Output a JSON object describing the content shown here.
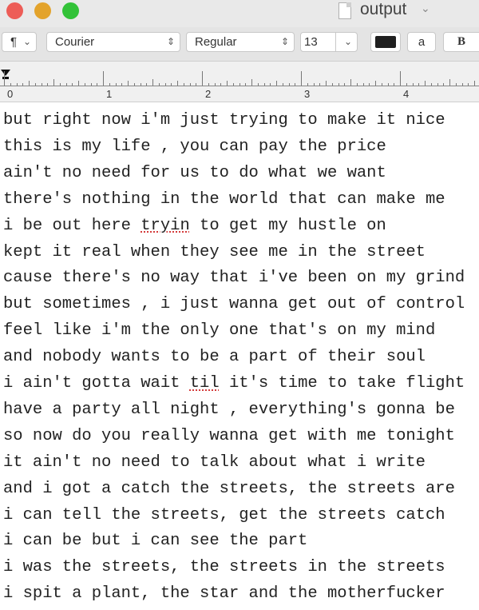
{
  "window": {
    "title": "output"
  },
  "toolbar": {
    "paragraph_icon": "¶",
    "font_family": "Courier",
    "font_style": "Regular",
    "font_size": "13",
    "highlight_label": "a",
    "bold_label": "B"
  },
  "ruler": {
    "numbers": [
      "0",
      "1",
      "2",
      "3",
      "4"
    ]
  },
  "editor": {
    "lines": [
      [
        "but right now i'm just trying to make it nice"
      ],
      [
        "this is my life , you can pay the price"
      ],
      [
        "ain't no need for us to do what we want"
      ],
      [
        "there's nothing in the world that can make me"
      ],
      [
        "i be out here ",
        "tryin",
        " to get my hustle on"
      ],
      [
        "kept it real when they see me in the street"
      ],
      [
        "cause there's no way that i've been on my grind"
      ],
      [
        "but sometimes , i just wanna get out of control"
      ],
      [
        "feel like i'm the only one that's on my mind"
      ],
      [
        "and nobody wants to be a part of their soul"
      ],
      [
        "i ain't gotta wait ",
        "til",
        " it's time to take flight"
      ],
      [
        "have a party all night , everything's gonna be"
      ],
      [
        "so now do you really wanna get with me tonight"
      ],
      [
        "it ain't no need to talk about what i write"
      ],
      [
        "and i got a catch the streets, the streets are"
      ],
      [
        "i can tell the streets, get the streets catch"
      ],
      [
        "i can be but i can see the part"
      ],
      [
        "i was the streets, the streets in the streets"
      ],
      [
        "i spit a plant, the star and the motherfucker"
      ]
    ]
  },
  "colors": {
    "close": "#ed5d57",
    "minimize": "#e3a32c",
    "zoom": "#32c238",
    "text_color_swatch": "#1f1f1f",
    "spelling_underline": "#d43b3b"
  }
}
